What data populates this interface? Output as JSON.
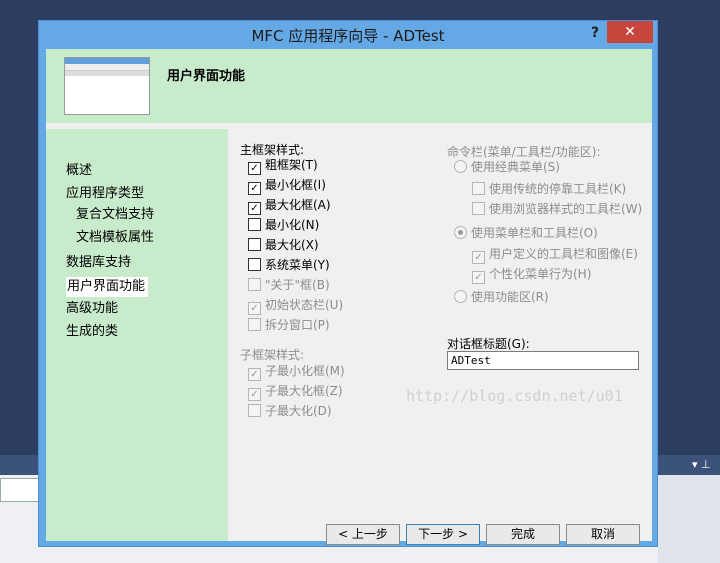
{
  "window": {
    "title": "MFC 应用程序向导 - ADTest",
    "help_label": "?",
    "close_label": "✕"
  },
  "header": {
    "title": "用户界面功能"
  },
  "nav": {
    "items": [
      {
        "label": "概述"
      },
      {
        "label": "应用程序类型"
      },
      {
        "label": "复合文档支持"
      },
      {
        "label": "文档模板属性"
      },
      {
        "label": "数据库支持"
      },
      {
        "label": "用户界面功能",
        "selected": true
      },
      {
        "label": "高级功能"
      },
      {
        "label": "生成的类"
      }
    ]
  },
  "main_frame": {
    "title": "主框架样式:",
    "options": [
      {
        "label": "粗框架(T)",
        "checked": true,
        "enabled": true
      },
      {
        "label": "最小化框(I)",
        "checked": true,
        "enabled": true
      },
      {
        "label": "最大化框(A)",
        "checked": true,
        "enabled": true
      },
      {
        "label": "最小化(N)",
        "checked": false,
        "enabled": true
      },
      {
        "label": "最大化(X)",
        "checked": false,
        "enabled": true
      },
      {
        "label": "系统菜单(Y)",
        "checked": false,
        "enabled": true
      },
      {
        "label": "\"关于\"框(B)",
        "checked": false,
        "enabled": false
      },
      {
        "label": "初始状态栏(U)",
        "checked": true,
        "enabled": false
      },
      {
        "label": "拆分窗口(P)",
        "checked": false,
        "enabled": false
      }
    ]
  },
  "child_frame": {
    "title": "子框架样式:",
    "options": [
      {
        "label": "子最小化框(M)",
        "checked": true,
        "enabled": false
      },
      {
        "label": "子最大化框(Z)",
        "checked": true,
        "enabled": false
      },
      {
        "label": "子最大化(D)",
        "checked": false,
        "enabled": false
      }
    ]
  },
  "command_bar": {
    "title": "命令栏(菜单/工具栏/功能区):",
    "classic_menu": {
      "label": "使用经典菜单(S)",
      "selected": false
    },
    "classic_options": [
      {
        "label": "使用传统的停靠工具栏(K)",
        "checked": false
      },
      {
        "label": "使用浏览器样式的工具栏(W)",
        "checked": false
      }
    ],
    "menubar_toolbar": {
      "label": "使用菜单栏和工具栏(O)",
      "selected": true
    },
    "menubar_options": [
      {
        "label": "用户定义的工具栏和图像(E)",
        "checked": true
      },
      {
        "label": "个性化菜单行为(H)",
        "checked": true
      }
    ],
    "ribbon": {
      "label": "使用功能区(R)",
      "selected": false
    }
  },
  "dialog_title": {
    "label": "对话框标题(G):",
    "value": "ADTest"
  },
  "buttons": {
    "prev": "< 上一步",
    "next": "下一步 >",
    "finish": "完成",
    "cancel": "取消"
  },
  "watermark": "http://blog.csdn.net/u01"
}
